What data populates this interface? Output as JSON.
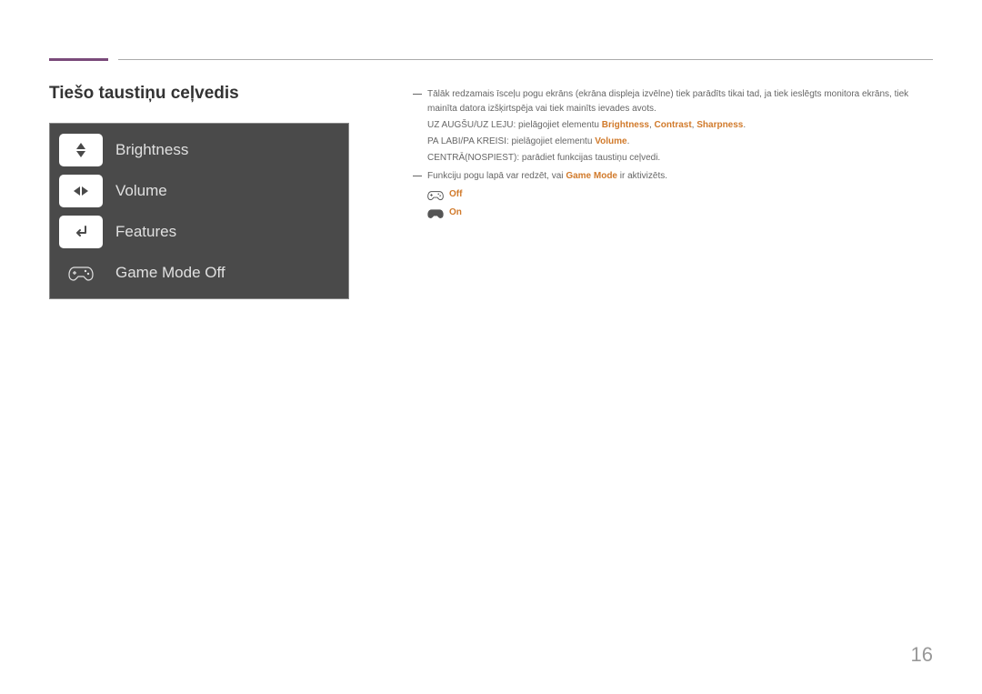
{
  "title": "Tiešo taustiņu ceļvedis",
  "osd": {
    "brightness": "Brightness",
    "volume": "Volume",
    "features": "Features",
    "gamemode": "Game Mode Off"
  },
  "desc": {
    "note1": "Tālāk redzamais īsceļu pogu ekrāns (ekrāna displeja izvēlne) tiek parādīts tikai tad, ja tiek ieslēgts monitora ekrāns, tiek mainīta datora izšķirtspēja vai tiek mainīts ievades avots.",
    "line_updown_prefix": "UZ AUGŠU/UZ LEJU: pielāgojiet elementu ",
    "line_lr_prefix": "PA LABI/PA KREISI: pielāgojiet elementu ",
    "line_center": "CENTRĀ(NOSPIEST): parādiet funkcijas taustiņu ceļvedi.",
    "note2_prefix": "Funkciju pogu lapā var redzēt, vai ",
    "note2_suffix": " ir aktivizēts.",
    "hl": {
      "brightness": "Brightness",
      "contrast": "Contrast",
      "sharpness": "Sharpness",
      "volume": "Volume",
      "gamemode": "Game Mode"
    },
    "status_off": "Off",
    "status_on": "On"
  },
  "page_number": "16"
}
